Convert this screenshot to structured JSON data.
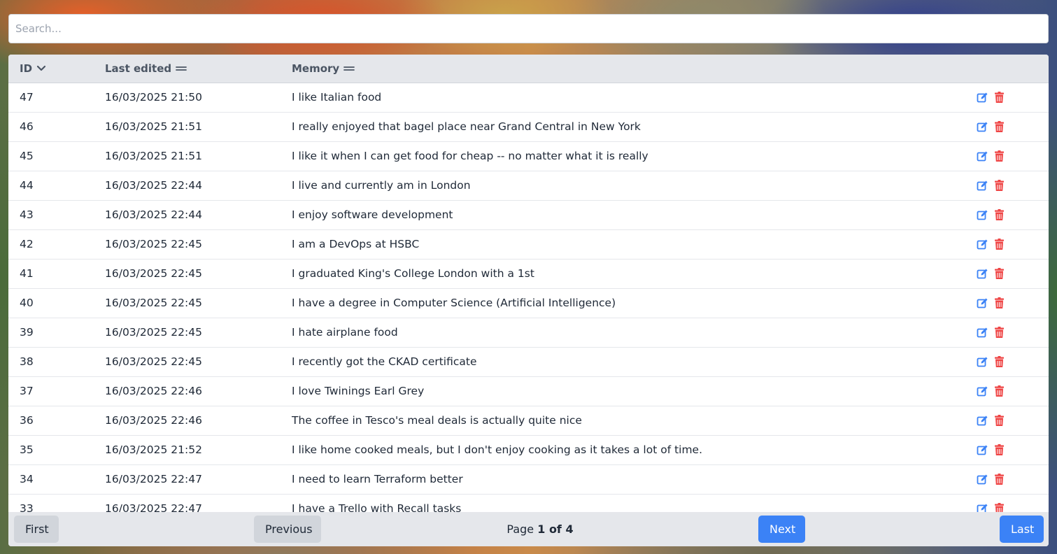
{
  "search": {
    "placeholder": "Search...",
    "value": ""
  },
  "table": {
    "columns": {
      "id": "ID",
      "last_edited": "Last edited",
      "memory": "Memory"
    },
    "sort_icons": {
      "id": "chevron-down-icon",
      "last_edited": "sort-handle-icon",
      "memory": "sort-handle-icon"
    },
    "rows": [
      {
        "id": "47",
        "last_edited": "16/03/2025 21:50",
        "memory": "I like Italian food"
      },
      {
        "id": "46",
        "last_edited": "16/03/2025 21:51",
        "memory": "I really enjoyed that bagel place near Grand Central in New York"
      },
      {
        "id": "45",
        "last_edited": "16/03/2025 21:51",
        "memory": "I like it when I can get food for cheap -- no matter what it is really"
      },
      {
        "id": "44",
        "last_edited": "16/03/2025 22:44",
        "memory": "I live and currently am in London"
      },
      {
        "id": "43",
        "last_edited": "16/03/2025 22:44",
        "memory": "I enjoy software development"
      },
      {
        "id": "42",
        "last_edited": "16/03/2025 22:45",
        "memory": "I am a DevOps at HSBC"
      },
      {
        "id": "41",
        "last_edited": "16/03/2025 22:45",
        "memory": "I graduated King's College London with a 1st"
      },
      {
        "id": "40",
        "last_edited": "16/03/2025 22:45",
        "memory": "I have a degree in Computer Science (Artificial Intelligence)"
      },
      {
        "id": "39",
        "last_edited": "16/03/2025 22:45",
        "memory": "I hate airplane food"
      },
      {
        "id": "38",
        "last_edited": "16/03/2025 22:45",
        "memory": "I recently got the CKAD certificate"
      },
      {
        "id": "37",
        "last_edited": "16/03/2025 22:46",
        "memory": "I love Twinings Earl Grey"
      },
      {
        "id": "36",
        "last_edited": "16/03/2025 22:46",
        "memory": "The coffee in Tesco's meal deals is actually quite nice"
      },
      {
        "id": "35",
        "last_edited": "16/03/2025 21:52",
        "memory": "I like home cooked meals, but I don't enjoy cooking as it takes a lot of time."
      },
      {
        "id": "34",
        "last_edited": "16/03/2025 22:47",
        "memory": "I need to learn Terraform better"
      },
      {
        "id": "33",
        "last_edited": "16/03/2025 22:47",
        "memory": "I have a Trello with Recall tasks"
      }
    ],
    "row_actions": {
      "edit_icon": "edit-icon",
      "delete_icon": "trash-icon"
    }
  },
  "pagination": {
    "first_label": "First",
    "previous_label": "Previous",
    "next_label": "Next",
    "last_label": "Last",
    "page_prefix": "Page",
    "current_page": "1",
    "of_word": "of",
    "total_pages": "4"
  },
  "colors": {
    "primary": "#3b82f6",
    "danger": "#ef4444",
    "edit": "#3b82f6",
    "header_bg": "#e5e7eb"
  }
}
